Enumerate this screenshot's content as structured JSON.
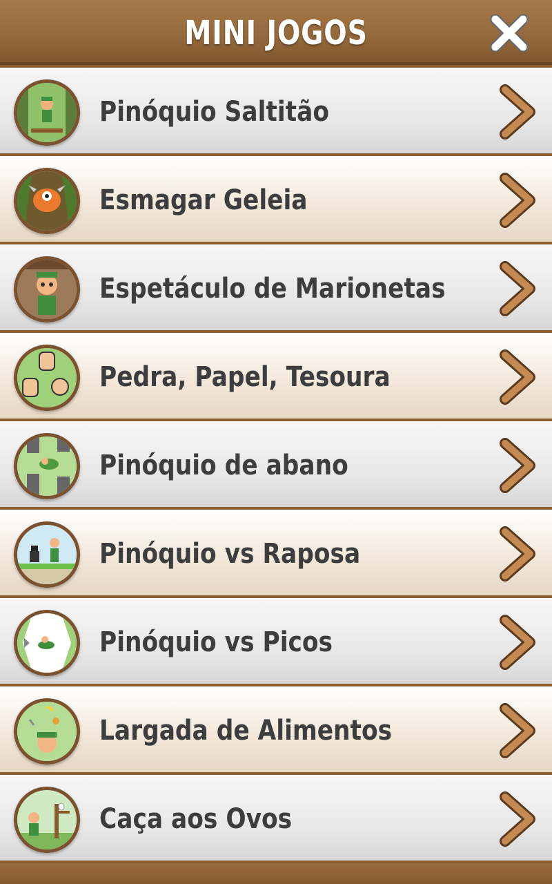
{
  "header": {
    "title": "MINI JOGOS",
    "close_icon": "close-x-icon"
  },
  "games": [
    {
      "label": "Pinóquio Saltitão",
      "icon": "pinocchio-jump-thumbnail",
      "style": "grey"
    },
    {
      "label": "Esmagar Geleia",
      "icon": "jelly-monster-thumbnail",
      "style": "beige"
    },
    {
      "label": "Espetáculo de Marionetas",
      "icon": "puppet-show-thumbnail",
      "style": "grey"
    },
    {
      "label": "Pedra, Papel, Tesoura",
      "icon": "rock-paper-scissors-thumbnail",
      "style": "beige"
    },
    {
      "label": "Pinóquio de abano",
      "icon": "flappy-pinocchio-thumbnail",
      "style": "grey"
    },
    {
      "label": "Pinóquio vs Raposa",
      "icon": "pinocchio-vs-fox-thumbnail",
      "style": "beige"
    },
    {
      "label": "Pinóquio vs Picos",
      "icon": "pinocchio-vs-spikes-thumbnail",
      "style": "grey"
    },
    {
      "label": "Largada de Alimentos",
      "icon": "food-drop-thumbnail",
      "style": "beige"
    },
    {
      "label": "Caça aos Ovos",
      "icon": "egg-hunt-thumbnail",
      "style": "grey"
    }
  ],
  "colors": {
    "header_brown": "#94693c",
    "chevron_brown": "#b57a45",
    "label_text": "#3d3d3d"
  }
}
